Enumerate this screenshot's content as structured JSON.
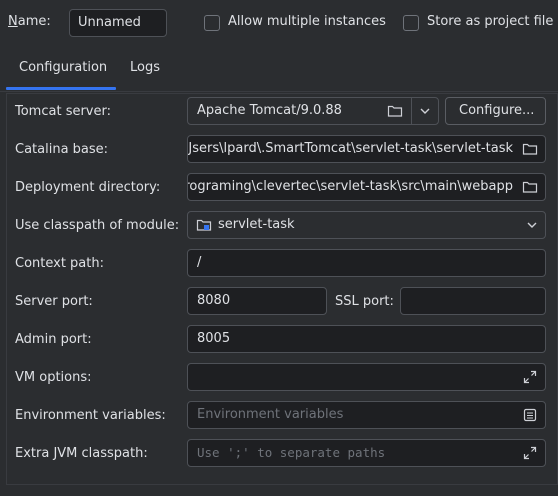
{
  "header": {
    "name_label_first": "N",
    "name_label_rest": "ame:",
    "name_value": "Unnamed",
    "allow_multiple_label": "Allow multiple instances",
    "store_project_label": "Store as project file"
  },
  "tabs": [
    {
      "label": "Configuration",
      "selected": true
    },
    {
      "label": "Logs",
      "selected": false
    }
  ],
  "form": {
    "tomcat_server": {
      "label": "Tomcat server:",
      "value": "Apache Tomcat/9.0.88",
      "configure_label": "Configure..."
    },
    "catalina_base": {
      "label": "Catalina base:",
      "value": "Jsers\\lpard\\.SmartTomcat\\servlet-task\\servlet-task"
    },
    "deployment_dir": {
      "label": "Deployment directory:",
      "value": "rograming\\clevertec\\servlet-task\\src\\main\\webapp"
    },
    "classpath_module": {
      "label": "Use classpath of module:",
      "value": "servlet-task"
    },
    "context_path": {
      "label": "Context path:",
      "value": "/"
    },
    "server_port": {
      "label": "Server port:",
      "value": "8080"
    },
    "ssl_port": {
      "label": "SSL port:",
      "value": ""
    },
    "admin_port": {
      "label": "Admin port:",
      "value": "8005"
    },
    "vm_options": {
      "label": "VM options:",
      "value": ""
    },
    "env_vars": {
      "label": "Environment variables:",
      "placeholder": "Environment variables"
    },
    "extra_jvm_classpath": {
      "label": "Extra JVM classpath:",
      "placeholder": "Use ';' to separate paths"
    }
  },
  "icons": {
    "folder": "folder-icon",
    "chevron": "chevron-down-icon",
    "expand": "expand-icon",
    "list": "list-icon",
    "module": "module-folder-icon"
  },
  "colors": {
    "background": "#2b2d30",
    "input_bg": "#1e1f22",
    "border": "#4e5157",
    "accent": "#3574f0",
    "text": "#dfe1e5",
    "placeholder": "#6f737a"
  }
}
